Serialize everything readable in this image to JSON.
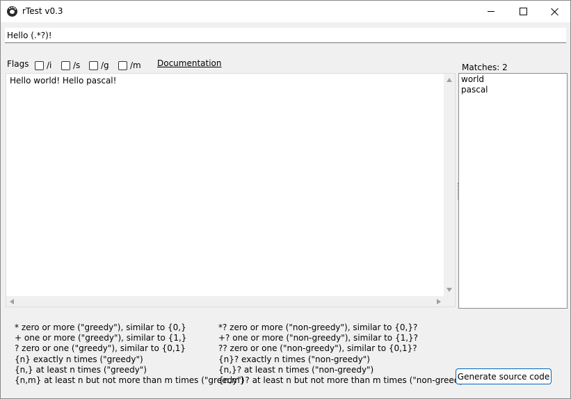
{
  "window": {
    "title": "rTest v0.3"
  },
  "regex": {
    "value": "Hello (.*?)!"
  },
  "flags": {
    "label": "Flags",
    "items": [
      {
        "label": "/i",
        "checked": false
      },
      {
        "label": "/s",
        "checked": false
      },
      {
        "label": "/g",
        "checked": false
      },
      {
        "label": "/m",
        "checked": false
      }
    ]
  },
  "documentation_link": "Documentation",
  "matches": {
    "label": "Matches:",
    "count": "2",
    "items": [
      "world",
      "pascal"
    ]
  },
  "test_text": "Hello world! Hello pascal!",
  "help": {
    "greedy": [
      "* zero or more (\"greedy\"), similar to {0,}",
      "+ one or more (\"greedy\"), similar to {1,}",
      "? zero or one (\"greedy\"), similar to {0,1}",
      "{n} exactly n times (\"greedy\")",
      "{n,} at least n times (\"greedy\")",
      "{n,m} at least n but not more than m times (\"greedy\")"
    ],
    "non_greedy": [
      "*? zero or more (\"non-greedy\"), similar to {0,}?",
      "+? one or more (\"non-greedy\"), similar to {1,}?",
      "?? zero or one (\"non-greedy\"), similar to {0,1}?",
      "{n}? exactly n times (\"non-greedy\")",
      "{n,}? at least n times (\"non-greedy\")",
      "{n,m}? at least n but not more than m times (\"non-greedy\")"
    ]
  },
  "generate_button": "Generate source code"
}
